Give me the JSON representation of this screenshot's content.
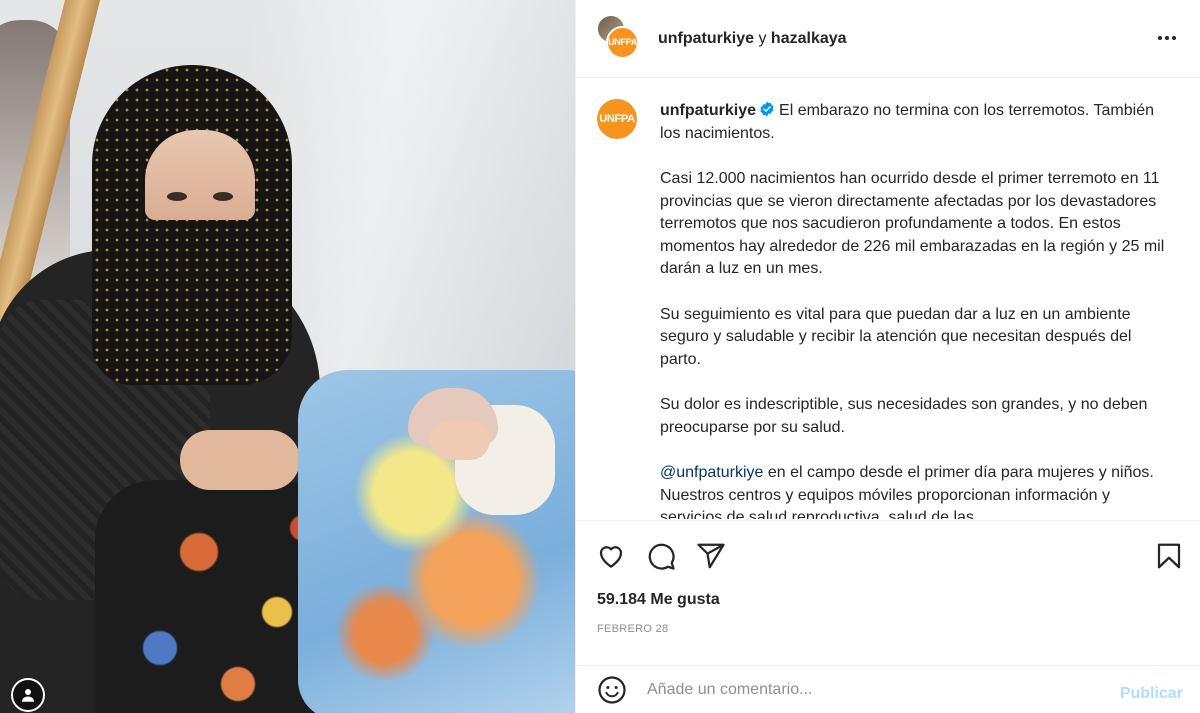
{
  "header": {
    "account1": "unfpaturkiye",
    "connector": "y",
    "account2": "hazalkaya",
    "logo_text": "UNFPA"
  },
  "caption": {
    "username": "unfpaturkiye",
    "logo_text": "UNFPA",
    "p1": "El embarazo no termina con los terremotos. También los nacimientos.",
    "p2": "Casi 12.000 nacimientos han ocurrido desde el primer terremoto en 11 provincias que se vieron directamente afectadas por los devastadores terremotos que nos sacudieron profundamente a todos. En estos momentos hay alrededor de 226 mil embarazadas en la región y 25 mil darán a luz en un mes.",
    "p3": "Su seguimiento es vital para que puedan dar a luz en un ambiente seguro y saludable y recibir la atención que necesitan después del parto.",
    "p4": "Su dolor es indescriptible, sus necesidades son grandes, y no deben preocuparse por su salud.",
    "p5_mention": "@unfpaturkiye",
    "p5": " en el campo desde el primer día para mujeres y niños. Nuestros centros y equipos móviles proporcionan información y servicios de salud reproductiva, salud de las"
  },
  "stats": {
    "likes": "59.184 Me gusta",
    "date": "FEBRERO 28"
  },
  "comment": {
    "placeholder": "Añade un comentario...",
    "publish_label": "Publicar"
  },
  "colors": {
    "brand": "#f7941d",
    "verified": "#0095f6",
    "publish_disabled": "#b3dbff",
    "mention": "#00376b"
  },
  "icons": [
    "heart-icon",
    "comment-icon",
    "share-icon",
    "bookmark-icon",
    "emoji-icon",
    "more-icon",
    "verified-icon",
    "profile-icon"
  ]
}
